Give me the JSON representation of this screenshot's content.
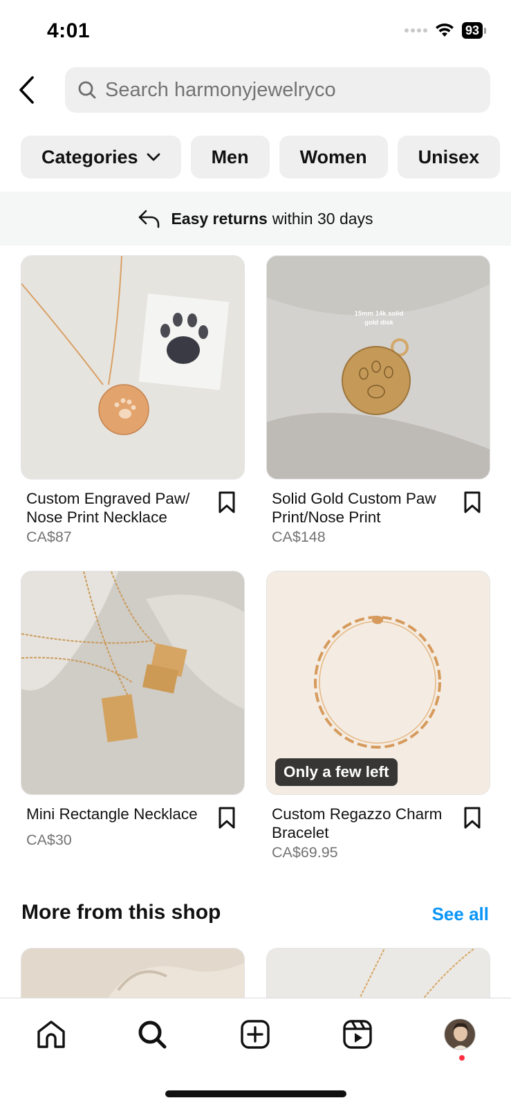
{
  "status_bar": {
    "time": "4:01",
    "battery": "93"
  },
  "search": {
    "placeholder": "Search harmonyjewelryco",
    "value": ""
  },
  "chips": [
    {
      "label": "Categories",
      "has_dropdown": true
    },
    {
      "label": "Men"
    },
    {
      "label": "Women"
    },
    {
      "label": "Unisex"
    }
  ],
  "returns_banner": {
    "bold": "Easy returns",
    "rest": "within 30 days"
  },
  "products": [
    {
      "title": "Custom Engraved Paw/ Nose Print Necklace",
      "price": "CA$87"
    },
    {
      "title": "Solid Gold Custom Paw Print/Nose Print",
      "price": "CA$148",
      "image_text_line1": "15mm 14k solid",
      "image_text_line2": "gold disk"
    },
    {
      "title": "Mini Rectangle Necklace",
      "price": "CA$30"
    },
    {
      "title": "Custom Regazzo Charm Bracelet",
      "price": "CA$69.95",
      "badge": "Only a few left"
    }
  ],
  "more_section": {
    "title": "More from this shop",
    "see_all": "See all"
  },
  "nav": {
    "items": [
      "home-icon",
      "search-icon",
      "create-icon",
      "reels-icon",
      "profile-avatar"
    ]
  },
  "colors": {
    "link": "#0a95f6",
    "notification": "#ff3040",
    "chip_bg": "#efefef",
    "price": "#737373"
  }
}
